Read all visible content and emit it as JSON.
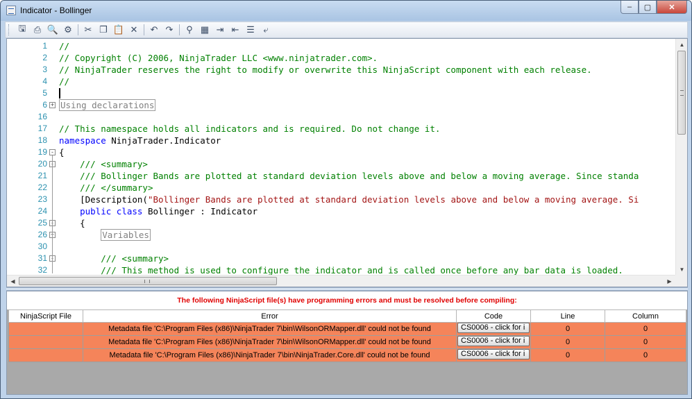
{
  "window": {
    "title": "Indicator - Bollinger",
    "controls": {
      "minimize": "–",
      "maximize": "▢",
      "close": "✕"
    }
  },
  "toolbar": {
    "buttons": [
      {
        "name": "save-icon",
        "glyph": "🖫"
      },
      {
        "name": "print-icon",
        "glyph": "⎙"
      },
      {
        "name": "print-preview-icon",
        "glyph": "🔍"
      },
      {
        "name": "page-setup-icon",
        "glyph": "⚙"
      },
      {
        "name": "cut-icon",
        "glyph": "✂"
      },
      {
        "name": "copy-icon",
        "glyph": "❐"
      },
      {
        "name": "paste-icon",
        "glyph": "📋"
      },
      {
        "name": "delete-icon",
        "glyph": "✕"
      },
      {
        "name": "undo-icon",
        "glyph": "↶"
      },
      {
        "name": "redo-icon",
        "glyph": "↷"
      },
      {
        "name": "find-icon",
        "glyph": "⚲"
      },
      {
        "name": "replace-icon",
        "glyph": "▦"
      },
      {
        "name": "indent-icon",
        "glyph": "⇥"
      },
      {
        "name": "outdent-icon",
        "glyph": "⇤"
      },
      {
        "name": "comment-icon",
        "glyph": "☰"
      },
      {
        "name": "uncomment-icon",
        "glyph": "⤶"
      }
    ]
  },
  "editor": {
    "lines": [
      {
        "n": "1",
        "fold": "",
        "indent": "",
        "segments": [
          {
            "c": "comment",
            "t": "//"
          }
        ]
      },
      {
        "n": "2",
        "fold": "",
        "indent": "",
        "segments": [
          {
            "c": "comment",
            "t": "// Copyright (C) 2006, NinjaTrader LLC <www.ninjatrader.com>."
          }
        ]
      },
      {
        "n": "3",
        "fold": "",
        "indent": "",
        "segments": [
          {
            "c": "comment",
            "t": "// NinjaTrader reserves the right to modify or overwrite this NinjaScript component with each release."
          }
        ]
      },
      {
        "n": "4",
        "fold": "",
        "indent": "",
        "segments": [
          {
            "c": "comment",
            "t": "//"
          }
        ]
      },
      {
        "n": "5",
        "fold": "",
        "indent": "",
        "segments": [],
        "caret": true
      },
      {
        "n": "6",
        "fold": "+",
        "indent": "",
        "segments": [
          {
            "c": "collapsed",
            "t": "Using declarations"
          }
        ]
      },
      {
        "n": "16",
        "fold": "",
        "indent": "",
        "segments": []
      },
      {
        "n": "17",
        "fold": "",
        "indent": "",
        "segments": [
          {
            "c": "comment",
            "t": "// This namespace holds all indicators and is required. Do not change it."
          }
        ]
      },
      {
        "n": "18",
        "fold": "",
        "indent": "",
        "segments": [
          {
            "c": "kw",
            "t": "namespace"
          },
          {
            "c": "",
            "t": " NinjaTrader.Indicator"
          }
        ]
      },
      {
        "n": "19",
        "fold": "-",
        "indent": "",
        "segments": [
          {
            "c": "",
            "t": "{"
          }
        ]
      },
      {
        "n": "20",
        "fold": "-",
        "indent": "    ",
        "segments": [
          {
            "c": "comment",
            "t": "/// <summary>"
          }
        ]
      },
      {
        "n": "21",
        "fold": "",
        "indent": "    ",
        "segments": [
          {
            "c": "comment",
            "t": "/// Bollinger Bands are plotted at standard deviation levels above and below a moving average. Since standa"
          }
        ]
      },
      {
        "n": "22",
        "fold": "",
        "indent": "    ",
        "segments": [
          {
            "c": "comment",
            "t": "/// </summary>"
          }
        ]
      },
      {
        "n": "23",
        "fold": "",
        "indent": "    ",
        "segments": [
          {
            "c": "",
            "t": "[Description("
          },
          {
            "c": "str",
            "t": "\"Bollinger Bands are plotted at standard deviation levels above and below a moving average. Si"
          }
        ]
      },
      {
        "n": "24",
        "fold": "",
        "indent": "    ",
        "segments": [
          {
            "c": "kw",
            "t": "public class"
          },
          {
            "c": "",
            "t": " Bollinger : Indicator"
          }
        ]
      },
      {
        "n": "25",
        "fold": "-",
        "indent": "    ",
        "segments": [
          {
            "c": "",
            "t": "{"
          }
        ]
      },
      {
        "n": "26",
        "fold": "+",
        "indent": "        ",
        "segments": [
          {
            "c": "collapsed",
            "t": "Variables"
          }
        ]
      },
      {
        "n": "30",
        "fold": "",
        "indent": "",
        "segments": []
      },
      {
        "n": "31",
        "fold": "-",
        "indent": "        ",
        "segments": [
          {
            "c": "comment",
            "t": "/// <summary>"
          }
        ]
      },
      {
        "n": "32",
        "fold": "",
        "indent": "        ",
        "segments": [
          {
            "c": "comment",
            "t": "/// This method is used to configure the indicator and is called once before any bar data is loaded."
          }
        ]
      }
    ],
    "hscroll_grip": "III"
  },
  "errors": {
    "banner": "The following NinjaScript file(s) have programming errors and must be resolved before compiling:",
    "columns": [
      "NinjaScript File",
      "Error",
      "Code",
      "Line",
      "Column"
    ],
    "rows": [
      {
        "file": "",
        "error": "Metadata file 'C:\\Program Files (x86)\\NinjaTrader 7\\bin\\WilsonORMapper.dll' could not be found",
        "code": "CS0006 - click for i",
        "line": "0",
        "column": "0"
      },
      {
        "file": "",
        "error": "Metadata file 'C:\\Program Files (x86)\\NinjaTrader 7\\bin\\WilsonORMapper.dll' could not be found",
        "code": "CS0006 - click for i",
        "line": "0",
        "column": "0"
      },
      {
        "file": "",
        "error": "Metadata file 'C:\\Program Files (x86)\\NinjaTrader 7\\bin\\NinjaTrader.Core.dll' could not be found",
        "code": "CS0006 - click for i",
        "line": "0",
        "column": "0"
      }
    ]
  },
  "colors": {
    "error_row": "#f5845a",
    "error_banner_text": "#e00000",
    "comment": "#008000",
    "keyword": "#0000ff",
    "string": "#a31515",
    "line_number": "#2b91af"
  }
}
